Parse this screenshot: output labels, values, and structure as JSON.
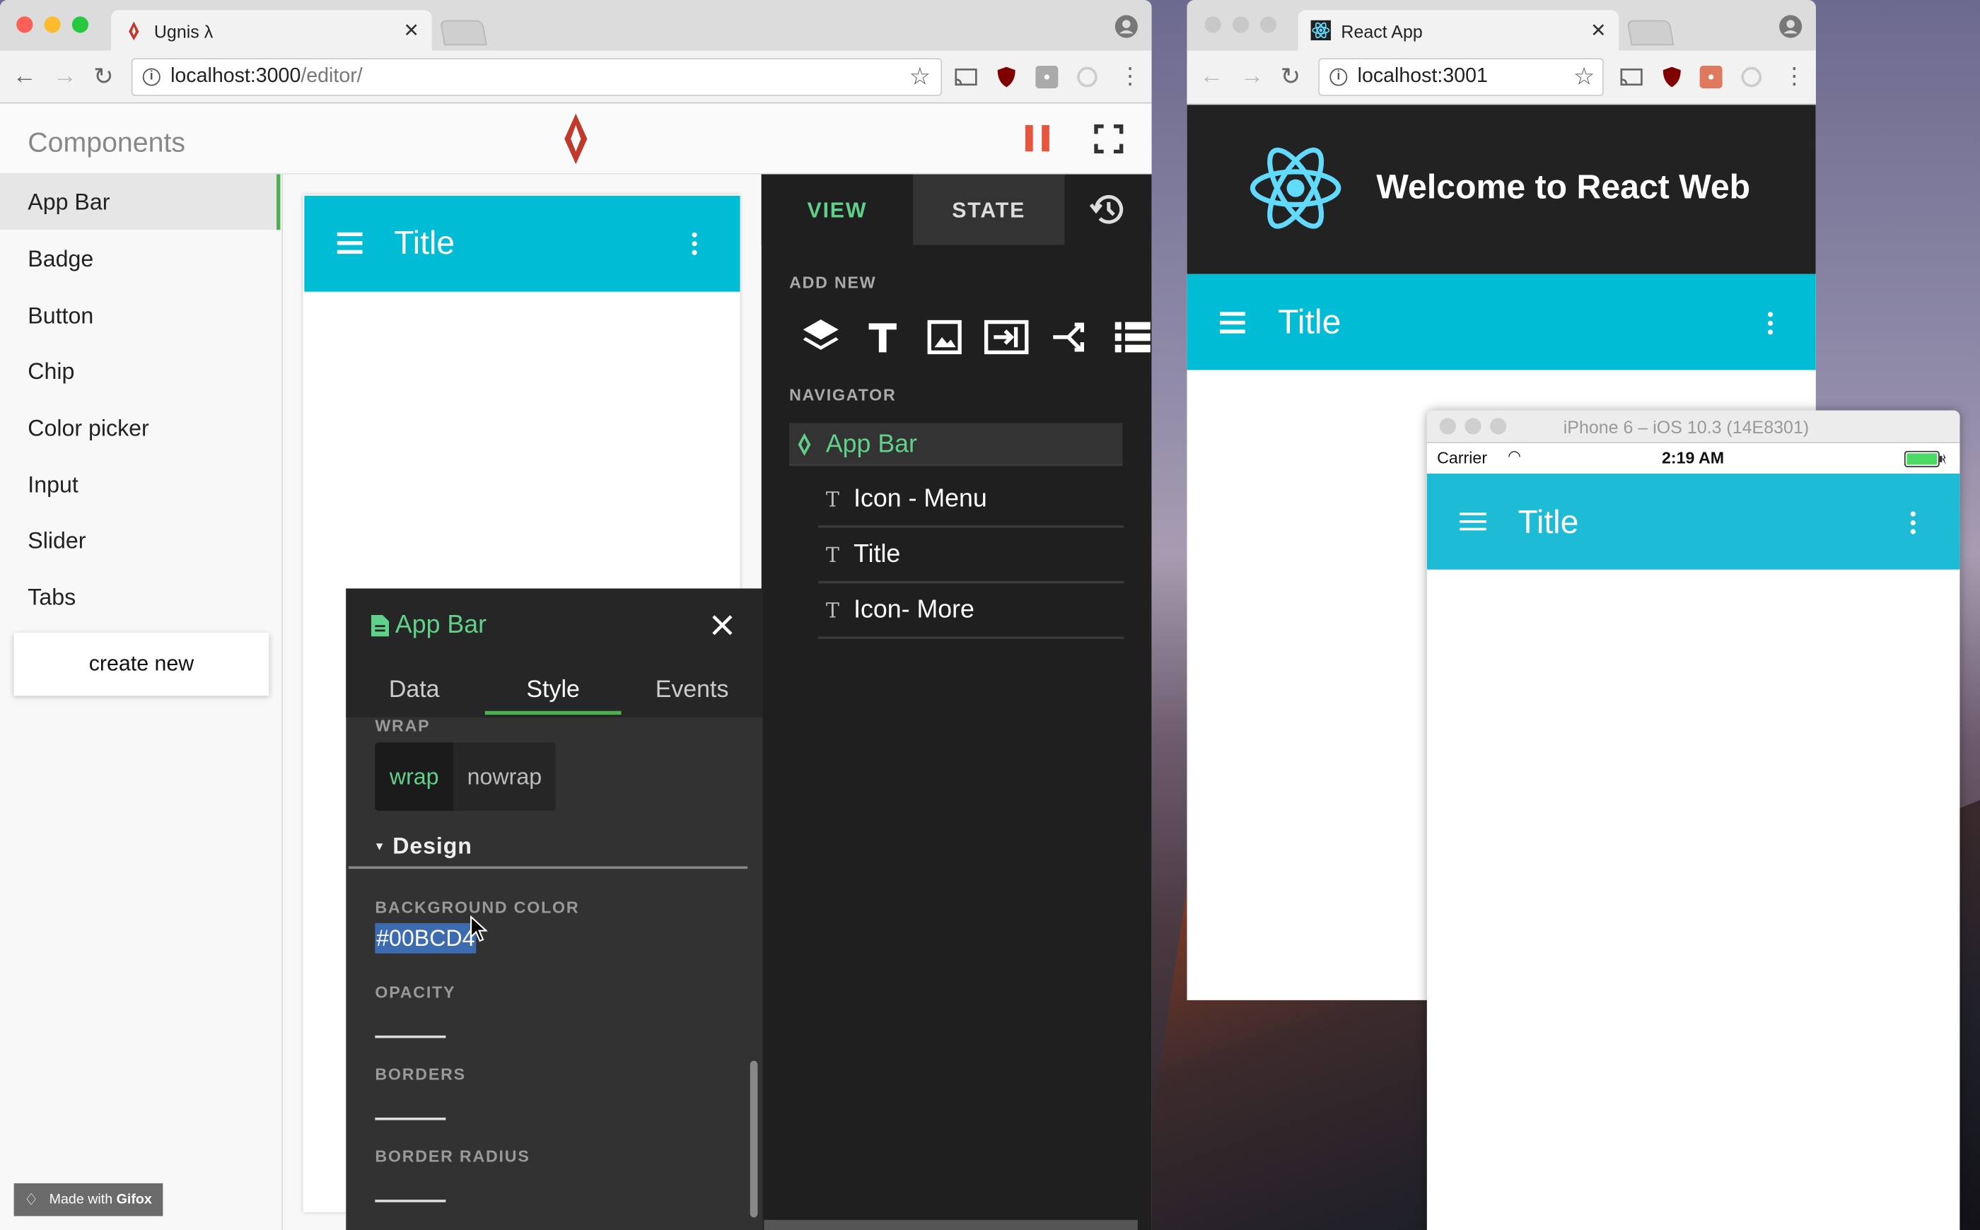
{
  "editor_window": {
    "tab_title": "Ugnis λ",
    "url": "localhost:3000/editor/",
    "url_host": "localhost:3000",
    "url_path": "/editor/",
    "sidebar": {
      "heading": "Components",
      "items": [
        {
          "label": "App Bar",
          "active": true
        },
        {
          "label": "Badge"
        },
        {
          "label": "Button"
        },
        {
          "label": "Chip"
        },
        {
          "label": "Color picker"
        },
        {
          "label": "Input"
        },
        {
          "label": "Slider"
        },
        {
          "label": "Tabs"
        }
      ],
      "create_label": "create new"
    },
    "preview_appbar_title": "Title",
    "right_panel": {
      "tabs": [
        "VIEW",
        "STATE"
      ],
      "add_new_label": "ADD NEW",
      "navigator_label": "NAVIGATOR",
      "navigator": {
        "root": "App Bar",
        "children": [
          "Icon - Menu",
          "Title",
          "Icon- More"
        ]
      }
    },
    "style_panel": {
      "title": "App Bar",
      "tabs": [
        "Data",
        "Style",
        "Events"
      ],
      "active_tab": "Style",
      "wrap_label": "WRAP",
      "wrap_options": [
        "wrap",
        "nowrap"
      ],
      "selected_wrap": "wrap",
      "design_label": "Design",
      "background_color_label": "BACKGROUND COLOR",
      "background_color_value": "#00BCD4",
      "opacity_label": "OPACITY",
      "borders_label": "BORDERS",
      "border_radius_label": "BORDER RADIUS"
    },
    "accent_color": "#4caf50",
    "pause_color": "#e8553e"
  },
  "react_window": {
    "tab_title": "React App",
    "url": "localhost:3001",
    "header_title": "Welcome to React Web",
    "appbar_title": "Title",
    "react_color": "#61dafb"
  },
  "simulator": {
    "window_title": "iPhone 6 – iOS 10.3 (14E8301)",
    "carrier": "Carrier",
    "time": "2:19 AM",
    "appbar_title": "Title"
  },
  "gifox_badge": {
    "prefix": "Made with ",
    "brand": "Gifox"
  },
  "colors": {
    "appbar": "#00bcd4",
    "ios_appbar": "#1ebbd7",
    "dark_panel": "#1f1f1f"
  }
}
